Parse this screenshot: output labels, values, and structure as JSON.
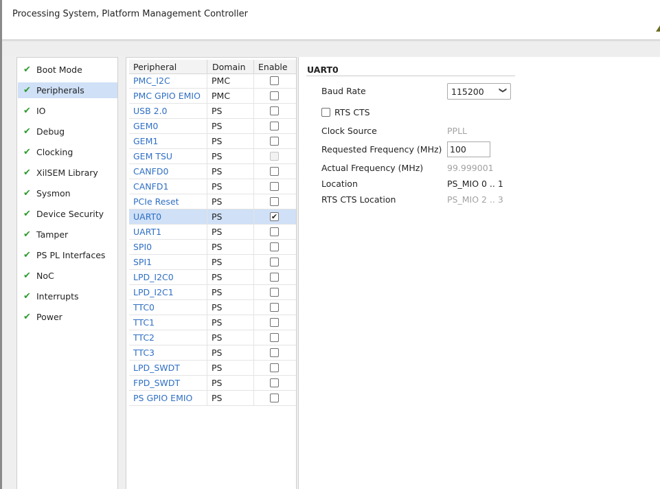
{
  "window": {
    "title": "Processing System, Platform Management Controller"
  },
  "nav": {
    "items": [
      {
        "label": "Boot Mode",
        "selected": false
      },
      {
        "label": "Peripherals",
        "selected": true
      },
      {
        "label": "IO",
        "selected": false
      },
      {
        "label": "Debug",
        "selected": false
      },
      {
        "label": "Clocking",
        "selected": false
      },
      {
        "label": "XilSEM Library",
        "selected": false
      },
      {
        "label": "Sysmon",
        "selected": false
      },
      {
        "label": "Device Security",
        "selected": false
      },
      {
        "label": "Tamper",
        "selected": false
      },
      {
        "label": "PS PL Interfaces",
        "selected": false
      },
      {
        "label": "NoC",
        "selected": false
      },
      {
        "label": "Interrupts",
        "selected": false
      },
      {
        "label": "Power",
        "selected": false
      }
    ],
    "check_glyph": "✔"
  },
  "table": {
    "headers": {
      "peripheral": "Peripheral",
      "domain": "Domain",
      "enable": "Enable"
    },
    "rows": [
      {
        "name": "PMC_I2C",
        "domain": "PMC",
        "enabled": false,
        "disabled": false
      },
      {
        "name": "PMC GPIO EMIO",
        "domain": "PMC",
        "enabled": false,
        "disabled": false
      },
      {
        "name": "USB 2.0",
        "domain": "PS",
        "enabled": false,
        "disabled": false
      },
      {
        "name": "GEM0",
        "domain": "PS",
        "enabled": false,
        "disabled": false
      },
      {
        "name": "GEM1",
        "domain": "PS",
        "enabled": false,
        "disabled": false
      },
      {
        "name": "GEM TSU",
        "domain": "PS",
        "enabled": false,
        "disabled": true
      },
      {
        "name": "CANFD0",
        "domain": "PS",
        "enabled": false,
        "disabled": false
      },
      {
        "name": "CANFD1",
        "domain": "PS",
        "enabled": false,
        "disabled": false
      },
      {
        "name": "PCIe Reset",
        "domain": "PS",
        "enabled": false,
        "disabled": false
      },
      {
        "name": "UART0",
        "domain": "PS",
        "enabled": true,
        "disabled": false,
        "selected": true
      },
      {
        "name": "UART1",
        "domain": "PS",
        "enabled": false,
        "disabled": false
      },
      {
        "name": "SPI0",
        "domain": "PS",
        "enabled": false,
        "disabled": false
      },
      {
        "name": "SPI1",
        "domain": "PS",
        "enabled": false,
        "disabled": false
      },
      {
        "name": "LPD_I2C0",
        "domain": "PS",
        "enabled": false,
        "disabled": false
      },
      {
        "name": "LPD_I2C1",
        "domain": "PS",
        "enabled": false,
        "disabled": false
      },
      {
        "name": "TTC0",
        "domain": "PS",
        "enabled": false,
        "disabled": false
      },
      {
        "name": "TTC1",
        "domain": "PS",
        "enabled": false,
        "disabled": false
      },
      {
        "name": "TTC2",
        "domain": "PS",
        "enabled": false,
        "disabled": false
      },
      {
        "name": "TTC3",
        "domain": "PS",
        "enabled": false,
        "disabled": false
      },
      {
        "name": "LPD_SWDT",
        "domain": "PS",
        "enabled": false,
        "disabled": false
      },
      {
        "name": "FPD_SWDT",
        "domain": "PS",
        "enabled": false,
        "disabled": false
      },
      {
        "name": "PS GPIO EMIO",
        "domain": "PS",
        "enabled": false,
        "disabled": false
      }
    ]
  },
  "detail": {
    "section_title": "UART0",
    "baud_rate": {
      "label": "Baud Rate",
      "value": "115200",
      "arrow": "❯"
    },
    "rts_cts": {
      "label": "RTS CTS",
      "checked": false
    },
    "clock_source": {
      "label": "Clock Source",
      "value": "PPLL"
    },
    "requested_freq": {
      "label": "Requested Frequency (MHz)",
      "value": "100"
    },
    "actual_freq": {
      "label": "Actual Frequency (MHz)",
      "value": "99.999001"
    },
    "location": {
      "label": "Location",
      "value": "PS_MIO 0 .. 1"
    },
    "rts_cts_location": {
      "label": "RTS CTS Location",
      "value": "PS_MIO 2 .. 3"
    }
  },
  "colors": {
    "accent_link": "#2f6fc4",
    "selection": "#cfe0f7",
    "check_green": "#2e9a2e"
  }
}
